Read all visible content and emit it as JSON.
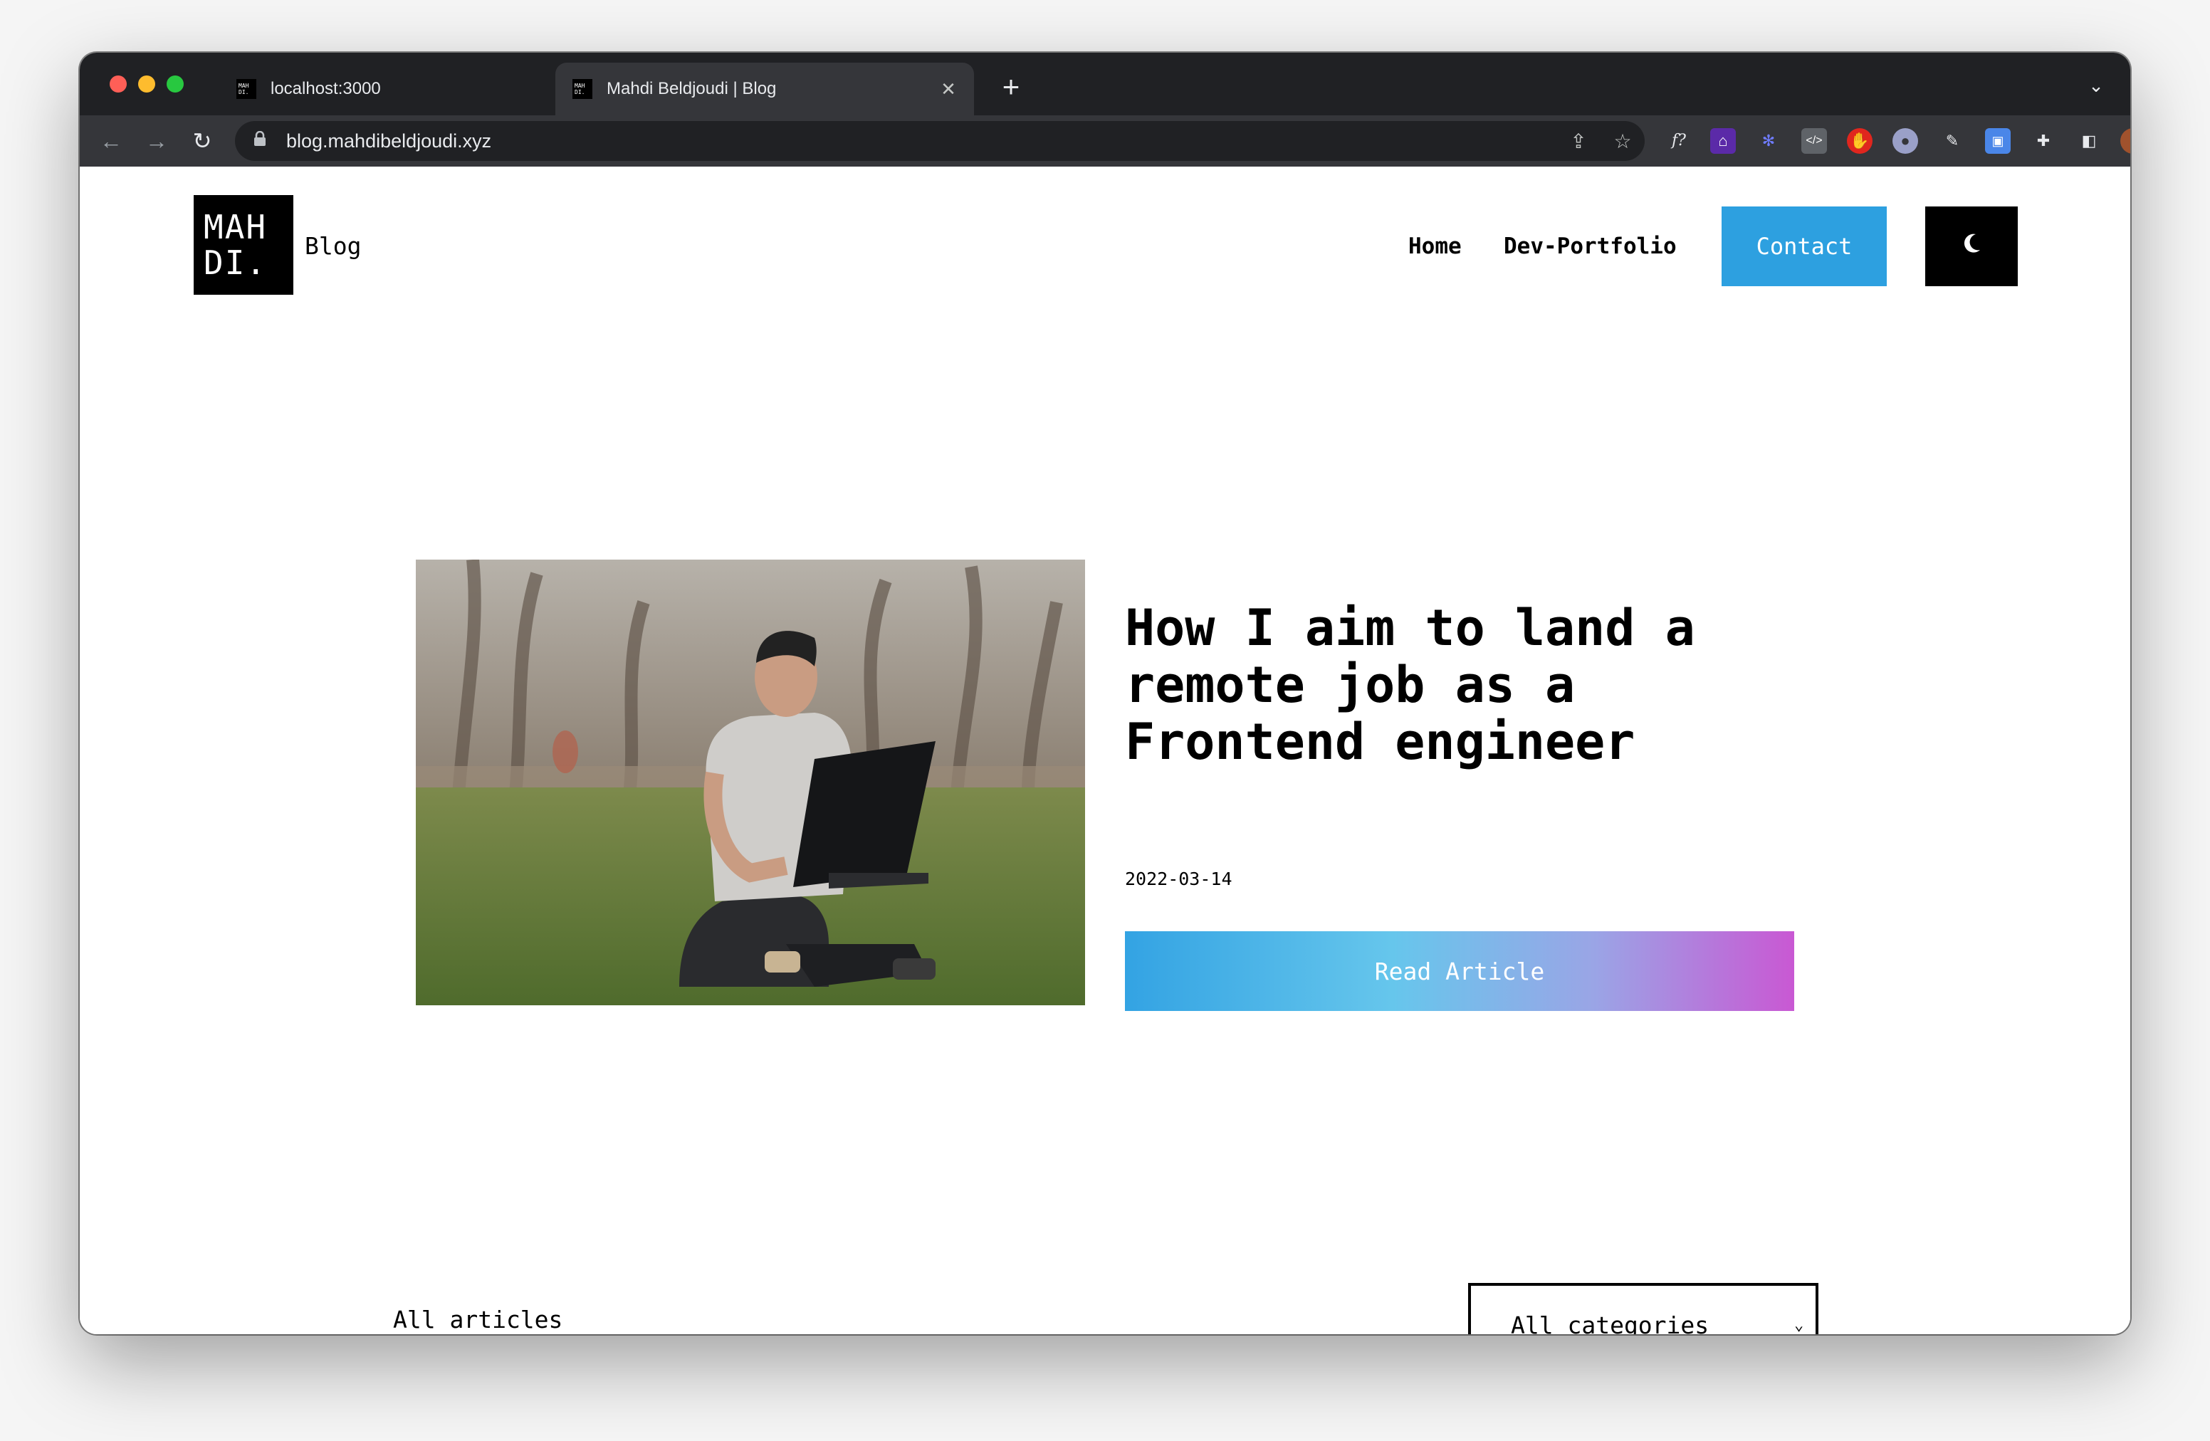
{
  "browser": {
    "tabs": [
      {
        "title": "localhost:3000",
        "favicon": "mahdi-logo-icon",
        "active": false
      },
      {
        "title": "Mahdi Beldjoudi | Blog",
        "favicon": "mahdi-logo-icon",
        "active": true
      }
    ],
    "new_tab_label": "+",
    "address_bar": {
      "url": "blog.mahdibeldjoudi.xyz"
    }
  },
  "site": {
    "logo": {
      "line1": "MAH",
      "line2": "DI."
    },
    "blog_label": "Blog",
    "nav": {
      "home": "Home",
      "portfolio": "Dev-Portfolio",
      "contact": "Contact"
    },
    "theme_toggle_icon": "moon-icon",
    "colors": {
      "contact": "#2da0e0",
      "gradient_start": "#33a3e3",
      "gradient_end": "#c958d3"
    }
  },
  "featured": {
    "title": "How I aim to land a remote job as a Frontend engineer",
    "date": "2022-03-14",
    "button": "Read Article",
    "image": "man-with-laptop-sitting-on-grass"
  },
  "filters": {
    "tab": "All articles",
    "category_select": "All categories"
  }
}
